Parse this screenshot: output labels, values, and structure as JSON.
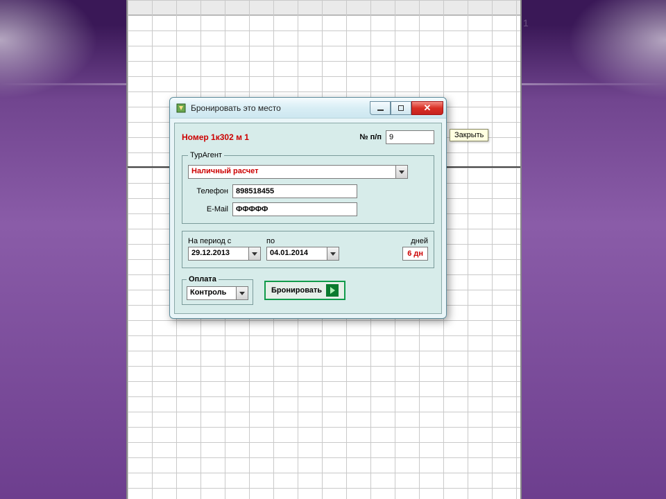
{
  "dialog": {
    "title": "Бронировать это место",
    "tooltip_close": "Закрыть",
    "room_label": "Номер 1к302 м 1",
    "order_no_label": "№ п/п",
    "order_no_value": "9",
    "touragent": {
      "legend": "ТурАгент",
      "payment_select": "Наличный расчет",
      "phone_label": "Телефон",
      "phone_value": "898518455",
      "email_label": "E-Mail",
      "email_value": "ФФФФФ"
    },
    "period": {
      "from_label": "На период с",
      "to_label": "по",
      "days_label": "дней",
      "from_value": "29.12.2013",
      "to_value": "04.01.2014",
      "days_value": "6 дн"
    },
    "payment": {
      "legend": "Оплата",
      "control_value": "Контроль"
    },
    "book_button": "Бронировать"
  }
}
